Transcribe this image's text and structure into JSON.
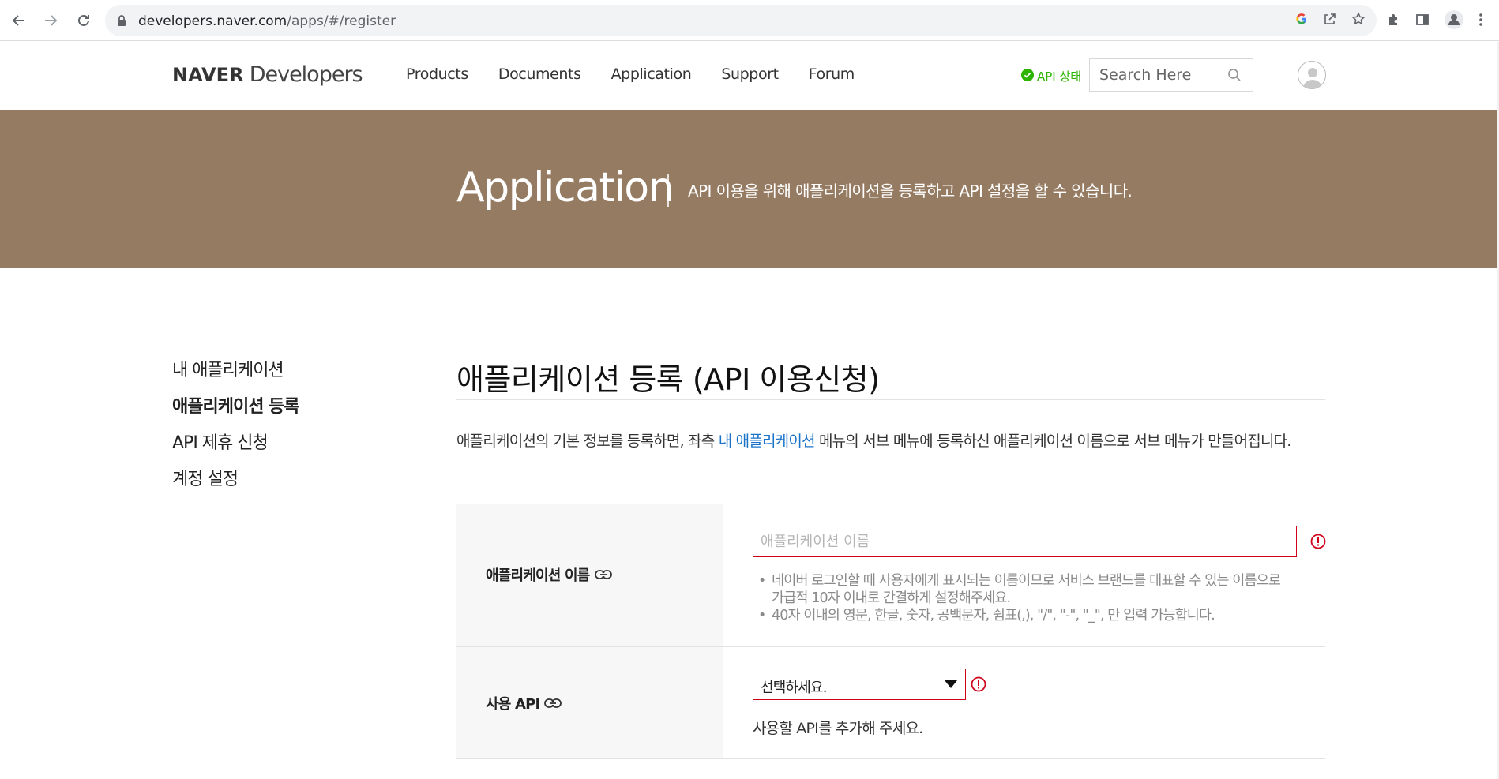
{
  "browser": {
    "url_host": "developers.naver.com",
    "url_path": "/apps/#/register",
    "icons": [
      "back-icon",
      "forward-icon",
      "reload-icon",
      "lock-icon",
      "google-icon",
      "share-icon",
      "star-icon",
      "extensions-icon",
      "sidepanel-icon",
      "profile-icon",
      "more-icon"
    ]
  },
  "header": {
    "logo_brand": "NAVER",
    "logo_product": "Developers",
    "nav": [
      "Products",
      "Documents",
      "Application",
      "Support",
      "Forum"
    ],
    "api_status": "API 상태",
    "search_placeholder": "Search Here"
  },
  "banner": {
    "title": "Application",
    "description": "API 이용을 위해 애플리케이션을 등록하고 API 설정을 할 수 있습니다."
  },
  "sidebar": {
    "items": [
      {
        "label": "내 애플리케이션",
        "active": false
      },
      {
        "label": "애플리케이션 등록",
        "active": true
      },
      {
        "label": "API 제휴 신청",
        "active": false
      },
      {
        "label": "계정 설정",
        "active": false
      }
    ]
  },
  "main": {
    "title": "애플리케이션 등록 (API 이용신청)",
    "intro_before": "애플리케이션의 기본 정보를 등록하면, 좌측 ",
    "intro_link": "내 애플리케이션",
    "intro_after": " 메뉴의 서브 메뉴에 등록하신 애플리케이션 이름으로 서브 메뉴가 만들어집니다.",
    "form": {
      "name_label": "애플리케이션 이름",
      "name_placeholder": "애플리케이션 이름",
      "name_value": "",
      "name_guides": [
        "네이버 로그인할 때 사용자에게 표시되는 이름이므로 서비스 브랜드를 대표할 수 있는 이름으로 가급적 10자 이내로 간결하게 설정해주세요.",
        "40자 이내의 영문, 한글, 숫자, 공백문자, 쉼표(,), \"/\", \"-\", \"_\", 만 입력 가능합니다."
      ],
      "api_label": "사용 API",
      "api_select_value": "선택하세요.",
      "api_hint": "사용할 API를 추가해 주세요."
    }
  },
  "colors": {
    "banner": "#967b63",
    "error": "#d0021b",
    "link": "#1a73c8",
    "status_green": "#2db400"
  }
}
